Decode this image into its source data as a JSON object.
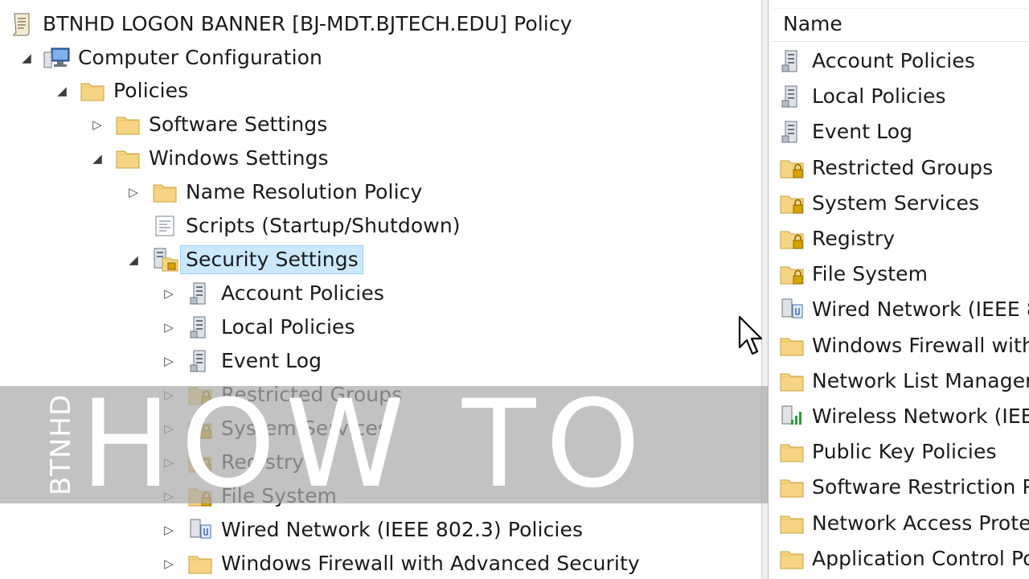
{
  "tree": {
    "items": [
      {
        "label": "BTNHD LOGON BANNER [BJ-MDT.BJTECH.EDU] Policy",
        "expander": "",
        "icon": "policy-scroll-icon"
      },
      {
        "label": "Computer Configuration",
        "expander": "◢",
        "icon": "computer-icon"
      },
      {
        "label": "Policies",
        "expander": "◢",
        "icon": "folder-icon"
      },
      {
        "label": "Software Settings",
        "expander": "▷",
        "icon": "folder-icon"
      },
      {
        "label": "Windows Settings",
        "expander": "◢",
        "icon": "folder-icon"
      },
      {
        "label": "Name Resolution Policy",
        "expander": "▷",
        "icon": "folder-icon"
      },
      {
        "label": "Scripts (Startup/Shutdown)",
        "expander": "",
        "icon": "script-icon"
      },
      {
        "label": "Security Settings",
        "expander": "◢",
        "icon": "security-settings-icon",
        "selected": true
      },
      {
        "label": "Account Policies",
        "expander": "▷",
        "icon": "server-icon"
      },
      {
        "label": "Local Policies",
        "expander": "▷",
        "icon": "server-icon"
      },
      {
        "label": "Event Log",
        "expander": "▷",
        "icon": "server-icon"
      },
      {
        "label": "Restricted Groups",
        "expander": "▷",
        "icon": "locked-folder-icon"
      },
      {
        "label": "System Services",
        "expander": "▷",
        "icon": "locked-folder-icon"
      },
      {
        "label": "Registry",
        "expander": "▷",
        "icon": "locked-folder-icon"
      },
      {
        "label": "File System",
        "expander": "▷",
        "icon": "locked-folder-icon"
      },
      {
        "label": "Wired Network (IEEE 802.3) Policies",
        "expander": "▷",
        "icon": "wired-network-icon"
      },
      {
        "label": "Windows Firewall with Advanced Security",
        "expander": "▷",
        "icon": "folder-icon"
      }
    ]
  },
  "list": {
    "header": "Name",
    "items": [
      {
        "label": "Account Policies",
        "icon": "server-icon"
      },
      {
        "label": "Local Policies",
        "icon": "server-icon"
      },
      {
        "label": "Event Log",
        "icon": "server-icon"
      },
      {
        "label": "Restricted Groups",
        "icon": "locked-folder-icon"
      },
      {
        "label": "System Services",
        "icon": "locked-folder-icon"
      },
      {
        "label": "Registry",
        "icon": "locked-folder-icon"
      },
      {
        "label": "File System",
        "icon": "locked-folder-icon"
      },
      {
        "label": "Wired Network (IEEE 8",
        "icon": "wired-network-icon"
      },
      {
        "label": "Windows Firewall with",
        "icon": "folder-icon"
      },
      {
        "label": "Network List Manager",
        "icon": "folder-icon"
      },
      {
        "label": "Wireless Network (IEEE",
        "icon": "wireless-network-icon"
      },
      {
        "label": "Public Key Policies",
        "icon": "folder-icon"
      },
      {
        "label": "Software Restriction Po",
        "icon": "folder-icon"
      },
      {
        "label": "Network Access Prote",
        "icon": "folder-icon"
      },
      {
        "label": "Application Control Po",
        "icon": "folder-icon"
      }
    ]
  },
  "overlay": {
    "brand": "BTNHD",
    "title": "HOW TO"
  },
  "colors": {
    "selection": "#cce8ff",
    "selection_border": "#99d1ff",
    "folder": "#f5d483",
    "overlay_band": "#aaaaaa"
  }
}
